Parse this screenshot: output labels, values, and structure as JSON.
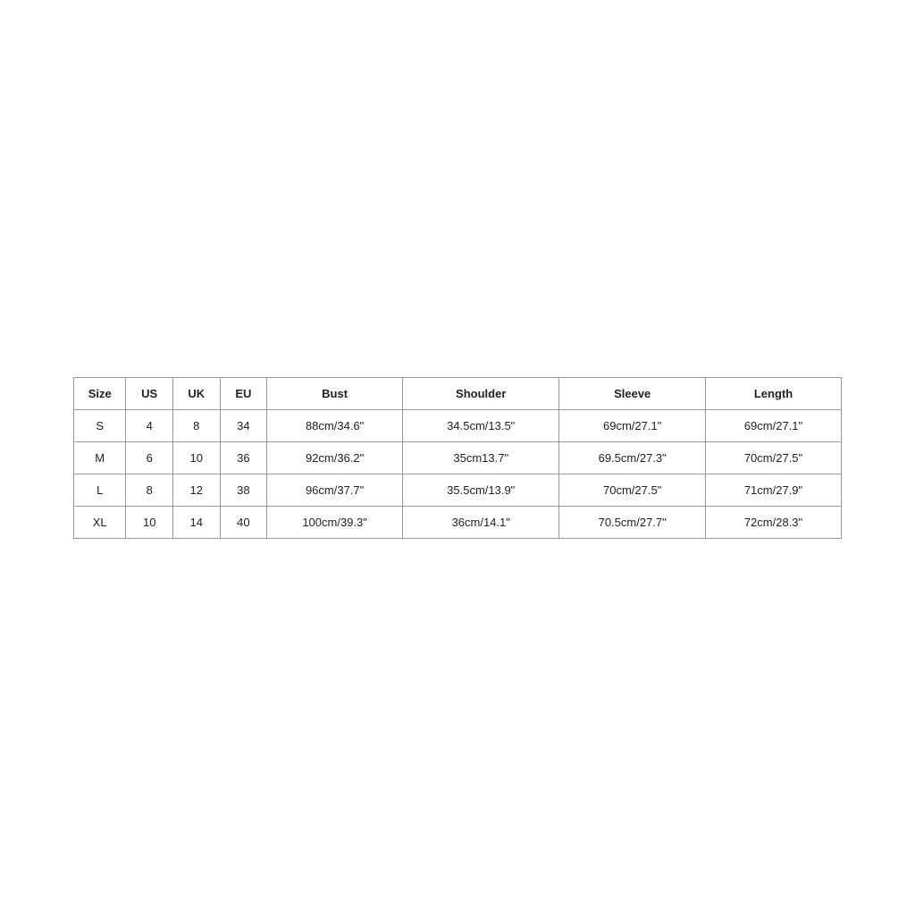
{
  "table": {
    "headers": {
      "size": "Size",
      "us": "US",
      "uk": "UK",
      "eu": "EU",
      "bust": "Bust",
      "shoulder": "Shoulder",
      "sleeve": "Sleeve",
      "length": "Length"
    },
    "rows": [
      {
        "size": "S",
        "us": "4",
        "uk": "8",
        "eu": "34",
        "bust": "88cm/34.6\"",
        "shoulder": "34.5cm/13.5\"",
        "sleeve": "69cm/27.1\"",
        "length": "69cm/27.1\""
      },
      {
        "size": "M",
        "us": "6",
        "uk": "10",
        "eu": "36",
        "bust": "92cm/36.2\"",
        "shoulder": "35cm13.7\"",
        "sleeve": "69.5cm/27.3\"",
        "length": "70cm/27.5\""
      },
      {
        "size": "L",
        "us": "8",
        "uk": "12",
        "eu": "38",
        "bust": "96cm/37.7\"",
        "shoulder": "35.5cm/13.9\"",
        "sleeve": "70cm/27.5\"",
        "length": "71cm/27.9\""
      },
      {
        "size": "XL",
        "us": "10",
        "uk": "14",
        "eu": "40",
        "bust": "100cm/39.3\"",
        "shoulder": "36cm/14.1\"",
        "sleeve": "70.5cm/27.7\"",
        "length": "72cm/28.3\""
      }
    ]
  }
}
